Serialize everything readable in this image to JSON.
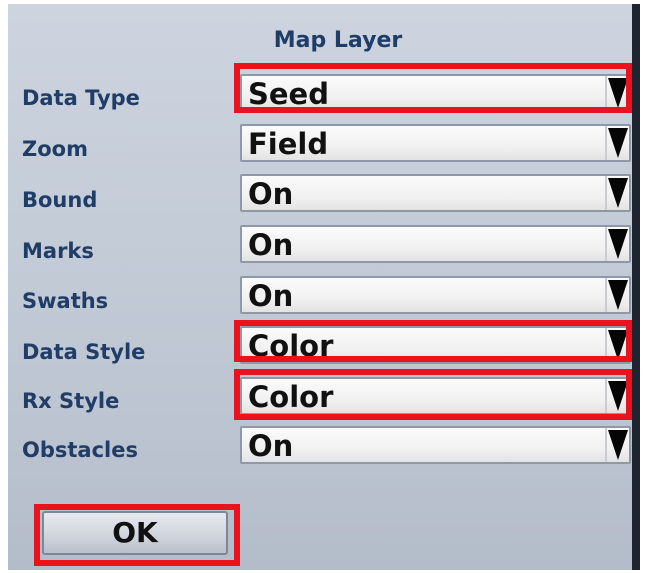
{
  "dialog": {
    "title": "Map Layer"
  },
  "rows": [
    {
      "label": "Data Type",
      "value": "Seed"
    },
    {
      "label": "Zoom",
      "value": "Field"
    },
    {
      "label": "Bound",
      "value": "On"
    },
    {
      "label": "Marks",
      "value": "On"
    },
    {
      "label": "Swaths",
      "value": "On"
    },
    {
      "label": "Data Style",
      "value": "Color"
    },
    {
      "label": "Rx Style",
      "value": "Color"
    },
    {
      "label": "Obstacles",
      "value": "On"
    }
  ],
  "ok_button": {
    "label": "OK"
  },
  "highlighted_controls": [
    "Data Type",
    "Data Style",
    "Rx Style",
    "OK"
  ],
  "colors": {
    "title_text": "#1f3d66",
    "highlight": "#e8131e",
    "dropdown_arrow": "#050505"
  },
  "icons": {
    "dropdown_arrow": "triangle-down-icon"
  }
}
